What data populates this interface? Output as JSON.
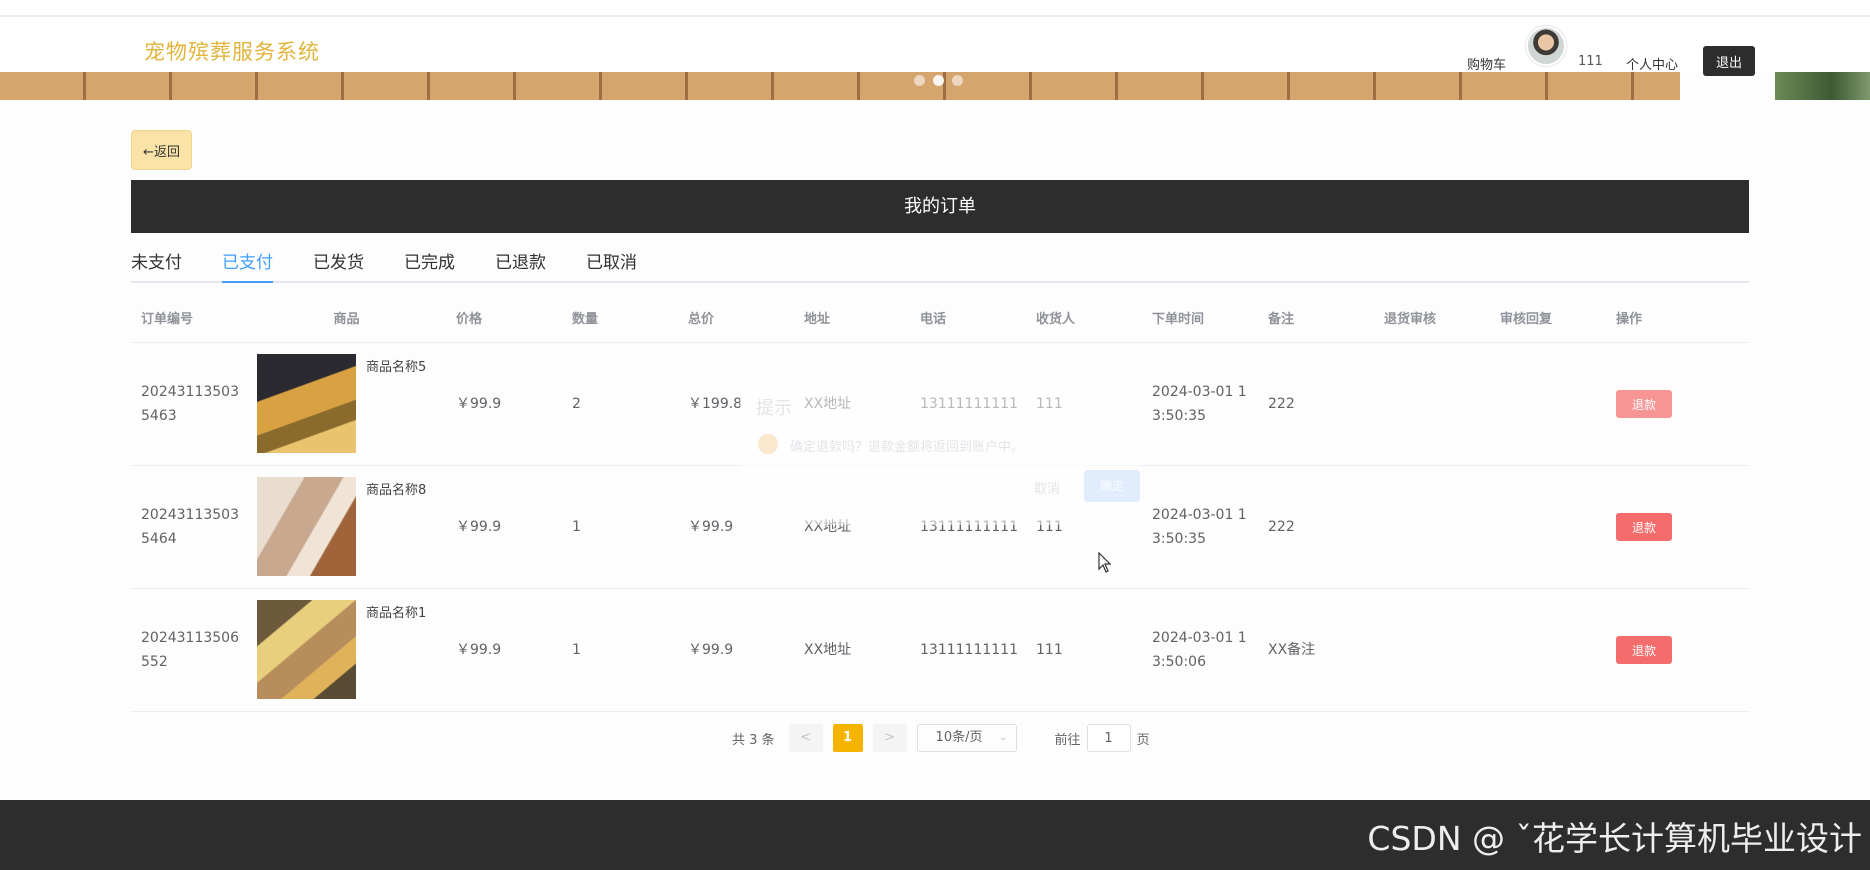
{
  "header": {
    "brand": "宠物殡葬服务系统",
    "cart": "购物车",
    "username": "111",
    "profile": "个人中心",
    "logout": "退出"
  },
  "back_button": "←返回",
  "page_title": "我的订单",
  "tabs": [
    {
      "label": "未支付",
      "active": false
    },
    {
      "label": "已支付",
      "active": true
    },
    {
      "label": "已发货",
      "active": false
    },
    {
      "label": "已完成",
      "active": false
    },
    {
      "label": "已退款",
      "active": false
    },
    {
      "label": "已取消",
      "active": false
    }
  ],
  "table": {
    "columns": [
      "订单编号",
      "商品",
      "价格",
      "数量",
      "总价",
      "地址",
      "电话",
      "收货人",
      "下单时间",
      "备注",
      "退货审核",
      "审核回复",
      "操作"
    ],
    "rows": [
      {
        "order_no": "202431135035463",
        "goods_name": "商品名称5",
        "price": "￥99.9",
        "qty": "2",
        "total": "￥199.8",
        "address": "XX地址",
        "phone": "13111111111",
        "receiver": "111",
        "time": "2024-03-01 13:50:35",
        "note": "222",
        "audit": "",
        "reply": "",
        "action": "退款"
      },
      {
        "order_no": "202431135035464",
        "goods_name": "商品名称8",
        "price": "￥99.9",
        "qty": "1",
        "total": "￥99.9",
        "address": "XX地址",
        "phone": "13111111111",
        "receiver": "111",
        "time": "2024-03-01 13:50:35",
        "note": "222",
        "audit": "",
        "reply": "",
        "action": "退款"
      },
      {
        "order_no": "20243113506552",
        "goods_name": "商品名称1",
        "price": "￥99.9",
        "qty": "1",
        "total": "￥99.9",
        "address": "XX地址",
        "phone": "13111111111",
        "receiver": "111",
        "time": "2024-03-01 13:50:06",
        "note": "XX备注",
        "audit": "",
        "reply": "",
        "action": "退款"
      }
    ]
  },
  "dialog_ghost": {
    "title": "提示",
    "message": "确定退款吗？退款金额将返回到账户中。",
    "cancel": "取消",
    "confirm": "确定"
  },
  "pagination": {
    "total": "共 3 条",
    "prev": "<",
    "current": "1",
    "next": ">",
    "page_size": "10条/页",
    "goto_label": "前往",
    "goto_value": "1",
    "page_suffix": "页"
  },
  "footer": {
    "watermark": "CSDN @ ˇ花学长计算机毕业设计"
  }
}
